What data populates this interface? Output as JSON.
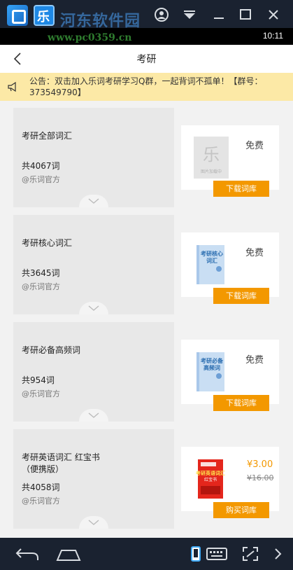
{
  "watermark": {
    "site": "河东软件园",
    "url": "www.pc0359.cn"
  },
  "status_bar": {
    "time": "10:11"
  },
  "header": {
    "title": "考研"
  },
  "notice": {
    "text": "公告：双击加入乐词考研学习Q群，一起背词不孤单！【群号：373549790】"
  },
  "books": [
    {
      "title": "考研全部词汇",
      "count": "共4067词",
      "owner": "@乐词官方",
      "price": "免费",
      "old_price": "",
      "action": "下载词库",
      "cover": "placeholder-cover",
      "cover_caption": "图片加载中"
    },
    {
      "title": "考研核心词汇",
      "count": "共3645词",
      "owner": "@乐词官方",
      "price": "免费",
      "old_price": "",
      "action": "下载词库",
      "cover": "blue-book-cover",
      "cover_caption": "考研核心词汇"
    },
    {
      "title": "考研必备高频词",
      "count": "共954词",
      "owner": "@乐词官方",
      "price": "免费",
      "old_price": "",
      "action": "下载词库",
      "cover": "blue-book-cover",
      "cover_caption": "考研必备高频词"
    },
    {
      "title": "考研英语词汇 红宝书（便携版）",
      "count": "共4058词",
      "owner": "@乐词官方",
      "price": "¥3.00",
      "old_price": "¥16.00",
      "action": "购买词库",
      "cover": "red-book-cover",
      "cover_caption": "考研英语词汇 红宝书"
    }
  ],
  "colors": {
    "accent": "#f39800",
    "notice_bg": "#fce9a6",
    "emulator_bar": "#1a2230"
  }
}
